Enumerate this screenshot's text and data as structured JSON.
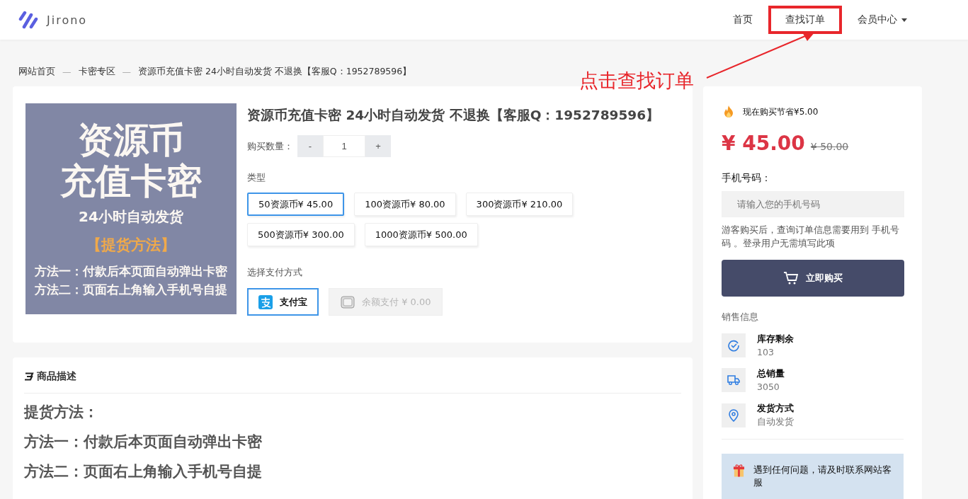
{
  "header": {
    "logo_text": "Jirono",
    "nav": [
      {
        "label": "首页",
        "kind": "link",
        "highlighted": false
      },
      {
        "label": "查找订单",
        "kind": "link",
        "highlighted": true
      },
      {
        "label": "会员中心",
        "kind": "dropdown",
        "highlighted": false
      }
    ]
  },
  "annotation": {
    "text": "点击查找订单"
  },
  "breadcrumb": {
    "separator": "—",
    "items": [
      "网站首页",
      "卡密专区",
      "资源币充值卡密 24小时自动发货 不退换【客服Q：1952789596】"
    ]
  },
  "product": {
    "image_lines": [
      {
        "kind": "big",
        "text": "资源币"
      },
      {
        "kind": "big",
        "text": "充值卡密"
      },
      {
        "kind": "sub",
        "text": "24小时自动发货"
      },
      {
        "kind": "accent",
        "text": "【提货方法】"
      },
      {
        "kind": "line",
        "text": "方法一：付款后本页面自动弹出卡密"
      },
      {
        "kind": "line",
        "text": "方法二：页面右上角输入手机号自提"
      }
    ],
    "title": "资源币充值卡密 24小时自动发货 不退换【客服Q：1952789596】",
    "quantity": {
      "label": "购买数量：",
      "minus": "-",
      "value": "1",
      "plus": "+"
    },
    "type_label": "类型",
    "types": [
      {
        "label": "50资源币¥ 45.00",
        "selected": true
      },
      {
        "label": "100资源币¥ 80.00",
        "selected": false
      },
      {
        "label": "300资源币¥ 210.00",
        "selected": false
      },
      {
        "label": "500资源币¥ 300.00",
        "selected": false
      },
      {
        "label": "1000资源币¥ 500.00",
        "selected": false
      }
    ],
    "payment_label": "选择支付方式",
    "payments": [
      {
        "kind": "alipay",
        "label": "支付宝",
        "selected": true,
        "disabled": false
      },
      {
        "kind": "wallet",
        "label": "余额支付 ¥ 0.00",
        "selected": false,
        "disabled": true
      }
    ]
  },
  "side": {
    "promo": "现在购买节省¥5.00",
    "price": "¥ 45.00",
    "old_price": "¥ 50.00",
    "phone_label": "手机号码：",
    "phone_placeholder": "请输入您的手机号码",
    "note": "游客购买后，查询订单信息需要用到 手机号码 。登录用户无需填写此项",
    "buy_button": "立即购买",
    "sales_label": "销售信息",
    "stats": [
      {
        "kind": "stock",
        "label": "库存剩余",
        "value": "103"
      },
      {
        "kind": "sales",
        "label": "总销量",
        "value": "3050"
      },
      {
        "kind": "delivery",
        "label": "发货方式",
        "value": "自动发货"
      }
    ],
    "notice": "遇到任何问题，请及时联系网站客服"
  },
  "description": {
    "title": "商品描述",
    "lines": [
      "提货方法：",
      "方法一：付款后本页面自动弹出卡密",
      "方法二：页面右上角输入手机号自提"
    ]
  }
}
